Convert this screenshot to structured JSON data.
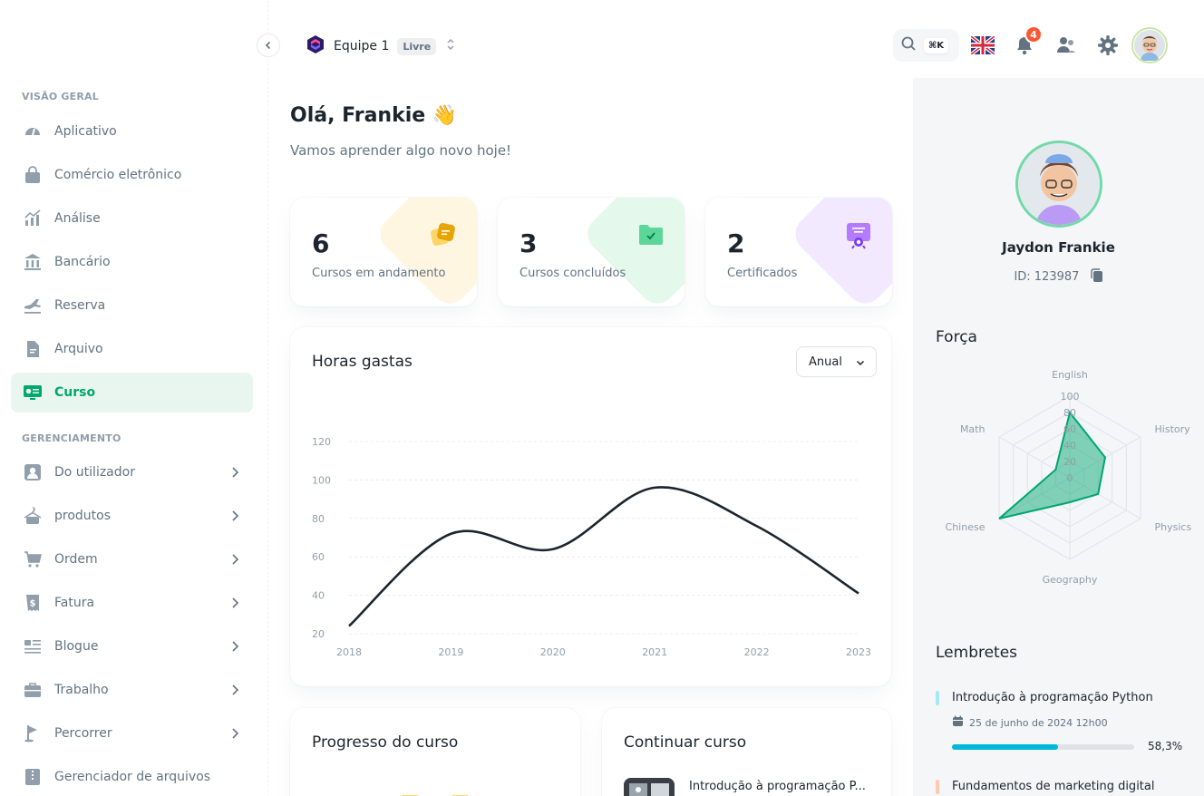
{
  "sidebar": {
    "sections": [
      {
        "title": "VISÃO GERAL",
        "items": [
          {
            "label": "Aplicativo"
          },
          {
            "label": "Comércio eletrônico"
          },
          {
            "label": "Análise"
          },
          {
            "label": "Bancário"
          },
          {
            "label": "Reserva"
          },
          {
            "label": "Arquivo"
          },
          {
            "label": "Curso",
            "active": true
          }
        ]
      },
      {
        "title": "GERENCIAMENTO",
        "items": [
          {
            "label": "Do utilizador"
          },
          {
            "label": "produtos"
          },
          {
            "label": "Ordem"
          },
          {
            "label": "Fatura"
          },
          {
            "label": "Blogue"
          },
          {
            "label": "Trabalho"
          },
          {
            "label": "Percorrer"
          },
          {
            "label": "Gerenciador de arquivos"
          }
        ]
      }
    ]
  },
  "header": {
    "team_name": "Equipe 1",
    "team_plan": "Livre",
    "search_shortcut": "⌘K",
    "notifications_count": "4"
  },
  "main": {
    "greeting": "Olá, Frankie 👋",
    "subtitle": "Vamos aprender algo novo hoje!",
    "stats": [
      {
        "value": "6",
        "label": "Cursos em andamento",
        "color": "#ffab00"
      },
      {
        "value": "3",
        "label": "Cursos concluídos",
        "color": "#22c55e"
      },
      {
        "value": "2",
        "label": "Certificados",
        "color": "#8e33ff"
      }
    ],
    "hours_card": {
      "title": "Horas gastas",
      "period": "Anual"
    },
    "progress_card": {
      "title": "Progresso do curso"
    },
    "continue_card": {
      "title": "Continuar curso",
      "course": "Introdução à programação P..."
    }
  },
  "chart_data": [
    {
      "type": "line",
      "title": "Horas gastas",
      "x": [
        "2018",
        "2019",
        "2020",
        "2021",
        "2022",
        "2023"
      ],
      "series": [
        {
          "values": [
            24,
            72,
            64,
            96,
            76,
            41
          ]
        }
      ],
      "ylim": [
        20,
        120
      ],
      "yticks": [
        20,
        40,
        60,
        80,
        100,
        120
      ],
      "grid": true,
      "color": "#1c252e"
    },
    {
      "type": "radar",
      "title": "Força",
      "categories": [
        "English",
        "History",
        "Physics",
        "Geography",
        "Chinese",
        "Math"
      ],
      "values": [
        80,
        50,
        40,
        30,
        100,
        20
      ],
      "scale_ticks": [
        "0",
        "20",
        "40",
        "60",
        "80",
        "100"
      ],
      "color": "#00a76f"
    }
  ],
  "profile": {
    "name": "Jaydon Frankie",
    "id_text": "ID: 123987",
    "strength_title": "Força"
  },
  "reminders": {
    "title": "Lembretes",
    "items": [
      {
        "title": "Introdução à programação Python",
        "date": "25 de junho de 2024 12h00",
        "progress": 0.583,
        "progress_label": "58,3%",
        "color": "#00b8d9"
      },
      {
        "title": "Fundamentos de marketing digital",
        "color": "#ffac82"
      }
    ]
  }
}
